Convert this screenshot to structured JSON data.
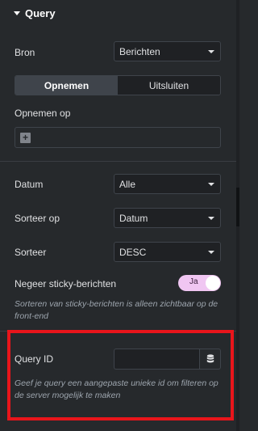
{
  "section": {
    "title": "Query"
  },
  "source": {
    "label": "Bron",
    "value": "Berichten"
  },
  "tabs": [
    {
      "label": "Opnemen",
      "active": true
    },
    {
      "label": "Uitsluiten",
      "active": false
    }
  ],
  "include_by": {
    "label": "Opnemen op",
    "add_button": "+"
  },
  "date": {
    "label": "Datum",
    "value": "Alle"
  },
  "order_by": {
    "label": "Sorteer op",
    "value": "Datum"
  },
  "order": {
    "label": "Sorteer",
    "value": "DESC"
  },
  "ignore_sticky": {
    "label": "Negeer sticky-berichten",
    "toggle_label": "Ja",
    "enabled": true,
    "note": "Sorteren van sticky-berichten is alleen zichtbaar op de front-end"
  },
  "query_id": {
    "label": "Query ID",
    "value": "",
    "placeholder": "",
    "help": "Geef je query een aangepaste unieke id om filteren op de server mogelijk te maken"
  },
  "colors": {
    "background": "#26292c",
    "toggle_on": "#f0c6f2",
    "highlight": "#e8151b"
  }
}
